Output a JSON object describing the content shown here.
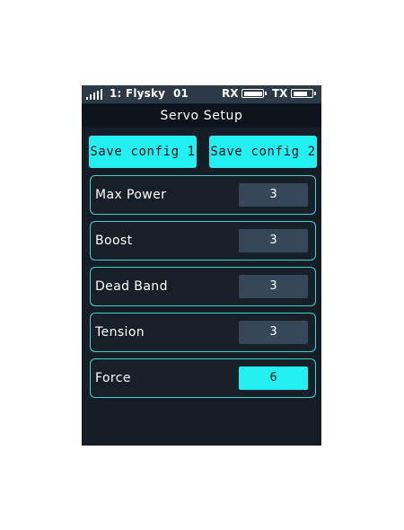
{
  "status_bar": {
    "model": "1: Flysky  01",
    "rx_label": "RX",
    "tx_label": "TX",
    "signal_icon": "signal-bars-icon",
    "rx_battery_icon": "battery-icon",
    "tx_battery_icon": "battery-icon"
  },
  "header": {
    "title": "Servo Setup"
  },
  "buttons": {
    "save_config_1": "Save config 1",
    "save_config_2": "Save config 2"
  },
  "settings": [
    {
      "label": "Max Power",
      "value": "3",
      "active": false
    },
    {
      "label": "Boost",
      "value": "3",
      "active": false
    },
    {
      "label": "Dead Band",
      "value": "3",
      "active": false
    },
    {
      "label": "Tension",
      "value": "3",
      "active": false
    },
    {
      "label": "Force",
      "value": "6",
      "active": true
    }
  ],
  "toolbar": {
    "icons": [
      "back-circle-icon",
      "minus-icon",
      "menu-icon",
      "plus-icon",
      "chevron-left-icon"
    ]
  },
  "colors": {
    "accent": "#23f0f0",
    "screen_background": "#151d26",
    "status_bar": "#2c3947",
    "toolbar": "#2c3a4d",
    "value_box": "#364759",
    "row_border": "#3fd3cf"
  }
}
